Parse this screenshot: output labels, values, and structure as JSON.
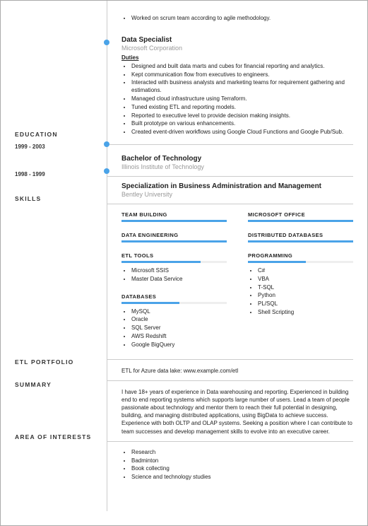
{
  "top_bullet": "Worked on scrum team according to agile methodology.",
  "job2": {
    "title": "Data Specialist",
    "company": "Microsoft Corporation",
    "duties_label": "Duties",
    "duties": [
      "Designed and built data marts and cubes for financial reporting and analytics.",
      "Kept communication flow from executives to engineers.",
      "Interacted with business analysts and marketing teams for requirement gathering and estimations.",
      "Managed cloud infrastructure using Terraform.",
      "Tuned existing ETL and reporting models.",
      "Reported to executive level to provide decision making insights.",
      "Built prototype on various enhancements.",
      "Created event-driven workflows using Google Cloud Functions and Google Pub/Sub."
    ]
  },
  "labels": {
    "education": "EDUCATION",
    "skills": "SKILLS",
    "etl": "ETL PORTFOLIO",
    "summary": "SUMMARY",
    "interests": "AREA OF INTERESTS"
  },
  "edu": [
    {
      "dates": "1999 - 2003",
      "degree": "Bachelor of Technology",
      "school": "Illinois Institute of Technology"
    },
    {
      "dates": "1998 - 1999",
      "degree": "Specialization in Business Administration and Management",
      "school": "Bentley University"
    }
  ],
  "skills_left": [
    {
      "name": "TEAM BUILDING",
      "val": 100,
      "items": null
    },
    {
      "name": "DATA ENGINEERING",
      "val": 100,
      "items": null
    },
    {
      "name": "ETL TOOLS",
      "val": 75,
      "items": [
        "Microsoft SSIS",
        "Master Data Service"
      ]
    },
    {
      "name": "DATABASES",
      "val": 55,
      "items": [
        "MySQL",
        "Oracle",
        "SQL Server",
        "AWS Redshift",
        "Google BigQuery"
      ]
    }
  ],
  "skills_right": [
    {
      "name": "MICROSOFT OFFICE",
      "val": 100,
      "items": null
    },
    {
      "name": "DISTRIBUTED DATABASES",
      "val": 100,
      "items": null
    },
    {
      "name": "PROGRAMMING",
      "val": 55,
      "items": [
        "C#",
        "VBA",
        "T-SQL",
        "Python",
        "PL/SQL",
        "Shell Scripting"
      ]
    }
  ],
  "etl_text": "ETL for Azure data lake: www.example.com/etl",
  "summary_text": "I have 18+ years of experience in Data warehousing and reporting. Experienced in building end to end reporting systems which supports large number of users. Lead a team of people passionate about technology and mentor them to reach their full potential in designing, building, and managing distributed applications, using BigData to achieve success. Experience with both OLTP and OLAP systems. Seeking a position where I can contribute to team successes and develop management skills to evolve into an executive career.",
  "interests": [
    "Research",
    "Badminton",
    "Book collecting",
    "Science and technology studies"
  ]
}
